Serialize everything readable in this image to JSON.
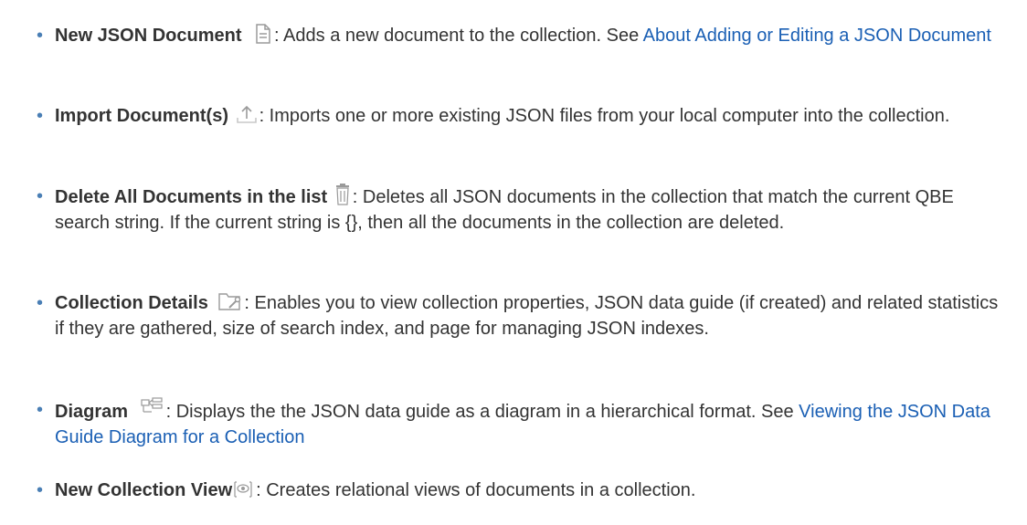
{
  "items": [
    {
      "term": "New JSON Document",
      "icon": "new-document-icon",
      "desc": ": Adds a new document to the collection. See ",
      "link": "About Adding or Editing a JSON Document"
    },
    {
      "term": "Import Document(s)",
      "icon": "import-upload-icon",
      "desc": ": Imports one or more existing JSON files from your local computer into the collection."
    },
    {
      "term": "Delete All Documents in the list",
      "icon": "trash-icon",
      "desc": ": Deletes all JSON documents in the collection that match the current QBE search string. If the current string is {}, then all the documents in the collection are deleted."
    },
    {
      "term": "Collection Details",
      "icon": "folder-wrench-icon",
      "desc": ": Enables you to view collection properties, JSON data guide (if created) and related statistics if they are gathered, size of search index, and page for managing JSON indexes."
    },
    {
      "term": "Diagram",
      "icon": "diagram-icon",
      "desc": ": Displays the the JSON data guide as a diagram in a hierarchical format. See ",
      "link": "Viewing the JSON Data Guide Diagram for a Collection"
    },
    {
      "term": "New Collection View",
      "icon": "eye-view-icon",
      "desc": ": Creates relational views of documents in a collection."
    }
  ],
  "colors": {
    "text": "#333333",
    "link": "#1a5fb4",
    "bullet": "#4a7fb5",
    "icon": "#9a9a9a"
  }
}
